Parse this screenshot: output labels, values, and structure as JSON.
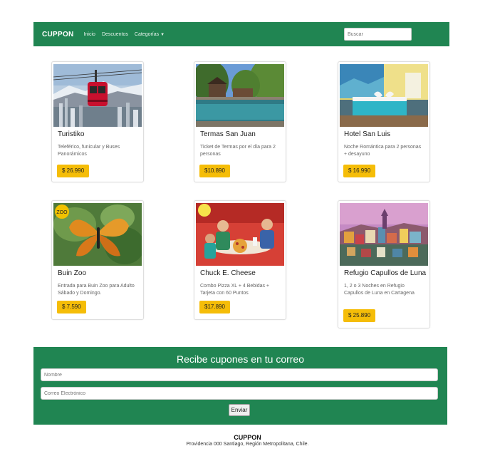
{
  "navbar": {
    "brand": "CUPPON",
    "links": [
      "Inicio",
      "Descuentos"
    ],
    "dropdown_label": "Categorías",
    "dropdown_icon": "chevron-down-icon",
    "search_placeholder": "Buscar"
  },
  "cards": [
    {
      "title": "Turistiko",
      "text": "Teleférico, funicular y Buses Panorámicos",
      "price": "$ 26.990"
    },
    {
      "title": "Termas San Juan",
      "text": "Ticket de Termas por el día para 2 personas",
      "price": "$10.890"
    },
    {
      "title": "Hotel San Luis",
      "text": "Noche Romántica para 2 personas + desayuno",
      "price": "$ 16.990"
    },
    {
      "title": "Buin Zoo",
      "text": "Entrada para Buin Zoo para Adulto Sábado y Domingo.",
      "price": "$ 7.590"
    },
    {
      "title": "Chuck E. Cheese",
      "text": "Combo Pizza XL + 4 Bebidas + Tarjeta con 60 Puntos",
      "price": "$17.890"
    },
    {
      "title": "Refugio Capullos de Luna",
      "text": "1, 2 o 3 Noches en Refugio Capullos de Luna en Cartagena",
      "price": "$ 25.890"
    }
  ],
  "newsletter": {
    "title": "Recibe cupones en tu correo",
    "name_placeholder": "Nombre",
    "email_placeholder": "Correo Electrónico",
    "submit_label": "Enviar"
  },
  "footer": {
    "brand": "CUPPON",
    "address": "Providencia 000 Santiago, Región Metropolitana, Chile."
  },
  "colors": {
    "brand_green": "#208552",
    "price_badge": "#f5bd08"
  }
}
